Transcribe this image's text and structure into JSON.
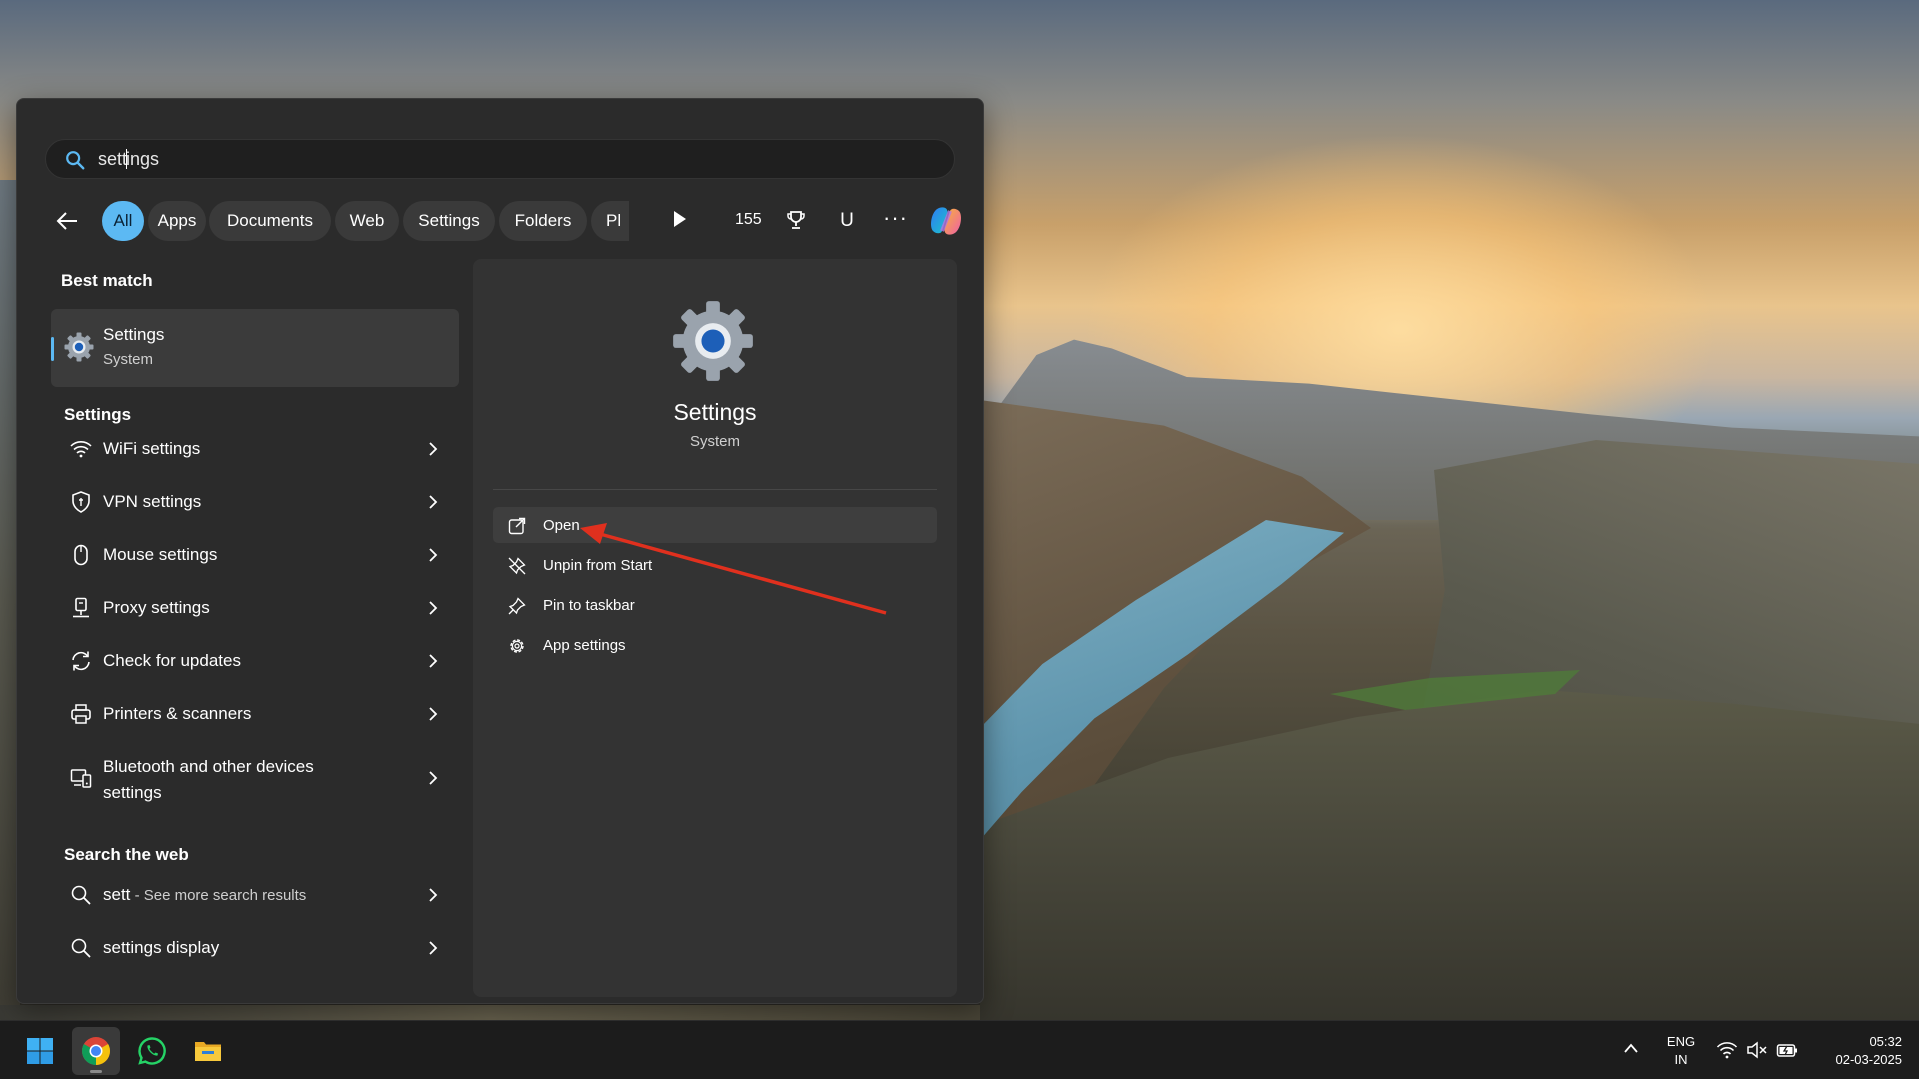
{
  "search": {
    "query_before_caret": "sett",
    "query_after_caret": "ings"
  },
  "filters": {
    "chips": [
      "All",
      "Apps",
      "Documents",
      "Web",
      "Settings",
      "Folders",
      "Pl"
    ],
    "active": "All",
    "points": "155",
    "avatar_letter": "U",
    "more_label": "···"
  },
  "best_match": {
    "heading": "Best match",
    "title": "Settings",
    "subtitle": "System"
  },
  "settings_section": {
    "heading": "Settings",
    "items": [
      {
        "label": "WiFi settings",
        "icon": "wifi-icon"
      },
      {
        "label": "VPN settings",
        "icon": "shield-icon"
      },
      {
        "label": "Mouse settings",
        "icon": "mouse-icon"
      },
      {
        "label": "Proxy settings",
        "icon": "proxy-icon"
      },
      {
        "label": "Check for updates",
        "icon": "refresh-icon"
      },
      {
        "label": "Printers & scanners",
        "icon": "printer-icon"
      },
      {
        "label_line1": "Bluetooth and other devices",
        "label_line2": "settings",
        "icon": "devices-icon"
      }
    ]
  },
  "web_section": {
    "heading": "Search the web",
    "items": [
      {
        "label": "sett",
        "suffix": " - See more search results",
        "icon": "search-icon"
      },
      {
        "label": "settings display",
        "icon": "search-icon"
      }
    ]
  },
  "preview": {
    "title": "Settings",
    "subtitle": "System",
    "actions": [
      {
        "label": "Open",
        "icon": "open-external-icon"
      },
      {
        "label": "Unpin from Start",
        "icon": "unpin-icon"
      },
      {
        "label": "Pin to taskbar",
        "icon": "pin-icon"
      },
      {
        "label": "App settings",
        "icon": "gear-icon"
      }
    ]
  },
  "taskbar": {
    "apps": [
      "windows-start-icon",
      "chrome-icon",
      "whatsapp-icon",
      "file-explorer-icon"
    ],
    "lang_line1": "ENG",
    "lang_line2": "IN",
    "time": "05:32",
    "date": "02-03-2025"
  },
  "colors": {
    "accent": "#5cb9f3",
    "annotation_arrow": "#e0301e"
  }
}
